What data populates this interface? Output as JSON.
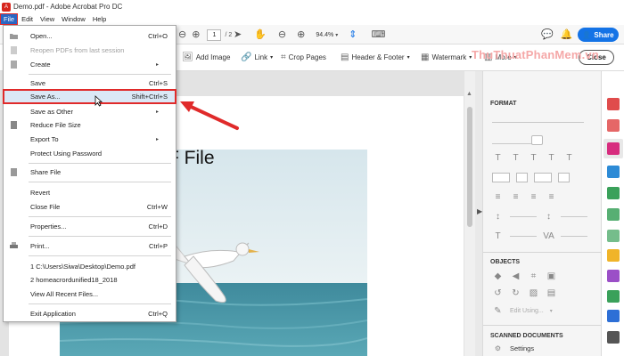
{
  "window": {
    "title": "Demo.pdf - Adobe Acrobat Pro DC"
  },
  "menubar": [
    "File",
    "Edit",
    "View",
    "Window",
    "Help"
  ],
  "toolbar": {
    "page_current": "1",
    "page_total": "/ 2",
    "zoom": "94.4%",
    "share_label": "Share"
  },
  "edit_toolbar": {
    "add_image": "Add Image",
    "link": "Link",
    "crop_pages": "Crop Pages",
    "header_footer": "Header & Footer",
    "watermark": "Watermark",
    "more": "More",
    "close": "Close"
  },
  "site_watermark": "ThuThuatPhanMem.vn",
  "document": {
    "heading": "F File"
  },
  "file_menu": {
    "open": {
      "label": "Open...",
      "shortcut": "Ctrl+O"
    },
    "reopen": {
      "label": "Reopen PDFs from last session"
    },
    "create": {
      "label": "Create"
    },
    "save": {
      "label": "Save",
      "shortcut": "Ctrl+S"
    },
    "save_as": {
      "label": "Save As...",
      "shortcut": "Shift+Ctrl+S"
    },
    "save_other": {
      "label": "Save as Other"
    },
    "reduce": {
      "label": "Reduce File Size"
    },
    "export": {
      "label": "Export To"
    },
    "protect": {
      "label": "Protect Using Password"
    },
    "share_file": {
      "label": "Share File"
    },
    "revert": {
      "label": "Revert"
    },
    "close_file": {
      "label": "Close File",
      "shortcut": "Ctrl+W"
    },
    "properties": {
      "label": "Properties...",
      "shortcut": "Ctrl+D"
    },
    "print": {
      "label": "Print...",
      "shortcut": "Ctrl+P"
    },
    "recent1": {
      "label": "1 C:\\Users\\Siwa\\Desktop\\Demo.pdf"
    },
    "recent2": {
      "label": "2 homeacrordunified18_2018"
    },
    "view_recent": {
      "label": "View All Recent Files..."
    },
    "exit": {
      "label": "Exit Application",
      "shortcut": "Ctrl+Q"
    }
  },
  "right_panel": {
    "format": "FORMAT",
    "objects": "OBJECTS",
    "edit_using": "Edit Using...",
    "scanned": "SCANNED DOCUMENTS",
    "settings": "Settings"
  },
  "colors": {
    "accent": "#1473e6",
    "menu_highlight": "#dbe8f6",
    "annotation_red": "#e02a2a",
    "active_tool": "#d72c7e"
  }
}
